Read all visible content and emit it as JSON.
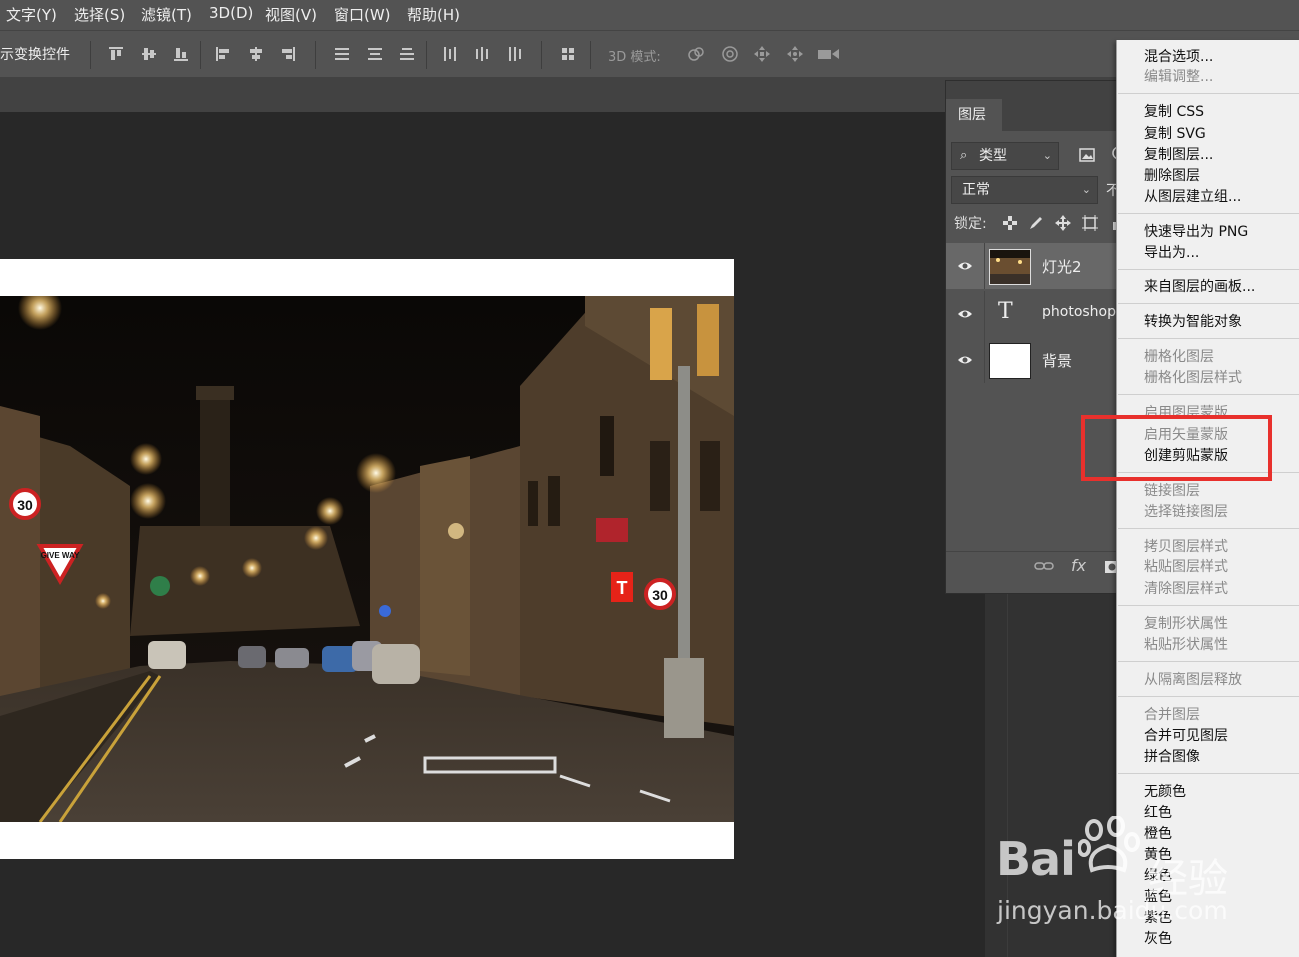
{
  "menubar": {
    "items": [
      "文字(Y)",
      "选择(S)",
      "滤镜(T)",
      "3D(D)",
      "视图(V)",
      "窗口(W)",
      "帮助(H)"
    ]
  },
  "optionsbar": {
    "transform_controls": "示变换控件",
    "mode_3d": "3D 模式:"
  },
  "layers_panel": {
    "tab": "图层",
    "filter_label": "类型",
    "blend_mode": "正常",
    "opacity_cut": "不",
    "lock_label": "锁定:",
    "layers": [
      {
        "name": "灯光2",
        "type": "image",
        "selected": true
      },
      {
        "name": "photoshop",
        "type": "text",
        "selected": false
      },
      {
        "name": "背景",
        "type": "background",
        "selected": false
      }
    ],
    "footer_fx": "fx"
  },
  "context_menu": {
    "items": [
      {
        "label": "混合选项...",
        "enabled": true
      },
      {
        "label": "编辑调整...",
        "enabled": false
      },
      {
        "label": "复制 CSS",
        "enabled": true
      },
      {
        "label": "复制 SVG",
        "enabled": true
      },
      {
        "label": "复制图层...",
        "enabled": true
      },
      {
        "label": "删除图层",
        "enabled": true
      },
      {
        "label": "从图层建立组...",
        "enabled": true
      },
      {
        "label": "快速导出为 PNG",
        "enabled": true
      },
      {
        "label": "导出为...",
        "enabled": true
      },
      {
        "label": "来自图层的画板...",
        "enabled": true
      },
      {
        "label": "转换为智能对象",
        "enabled": true
      },
      {
        "label": "栅格化图层",
        "enabled": false
      },
      {
        "label": "栅格化图层样式",
        "enabled": false
      },
      {
        "label": "启用图层蒙版",
        "enabled": false
      },
      {
        "label": "启用矢量蒙版",
        "enabled": false
      },
      {
        "label": "创建剪贴蒙版",
        "enabled": true
      },
      {
        "label": "链接图层",
        "enabled": false
      },
      {
        "label": "选择链接图层",
        "enabled": false
      },
      {
        "label": "拷贝图层样式",
        "enabled": false
      },
      {
        "label": "粘贴图层样式",
        "enabled": false
      },
      {
        "label": "清除图层样式",
        "enabled": false
      },
      {
        "label": "复制形状属性",
        "enabled": false
      },
      {
        "label": "粘贴形状属性",
        "enabled": false
      },
      {
        "label": "从隔离图层释放",
        "enabled": false
      },
      {
        "label": "合并图层",
        "enabled": false
      },
      {
        "label": "合并可见图层",
        "enabled": true
      },
      {
        "label": "拼合图像",
        "enabled": true
      },
      {
        "label": "无颜色",
        "enabled": true
      },
      {
        "label": "红色",
        "enabled": true
      },
      {
        "label": "橙色",
        "enabled": true
      },
      {
        "label": "黄色",
        "enabled": true
      },
      {
        "label": "绿色",
        "enabled": true
      },
      {
        "label": "蓝色",
        "enabled": true
      },
      {
        "label": "紫色",
        "enabled": true
      },
      {
        "label": "灰色",
        "enabled": true
      }
    ]
  },
  "photo_signs": {
    "speed_left": "30",
    "give_way": "GIVE WAY",
    "speed_right": "30",
    "shop_sign": "T"
  },
  "watermark": {
    "brand": "Bai",
    "brand2": "经验",
    "url": "jingyan.baidu.com"
  },
  "colors": {
    "highlight_box": "#e8302c",
    "panel_bg": "#535353",
    "menu_bg": "#f0f0f0"
  }
}
